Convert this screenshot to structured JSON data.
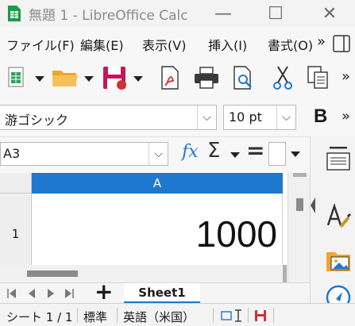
{
  "window": {
    "title": "無題 1 - LibreOffice Calc",
    "minimize": "—",
    "maximize": "☐",
    "close": "✕"
  },
  "menu": {
    "items": [
      "ファイル(F)",
      "編集(E)",
      "表示(V)",
      "挿入(I)",
      "書式(O)"
    ],
    "overflow": "»"
  },
  "toolbar": {
    "icons": [
      "new-spreadsheet-icon",
      "open-folder-icon",
      "save-icon",
      "export-pdf-icon",
      "print-icon",
      "print-preview-icon",
      "cut-icon",
      "copy-icon"
    ],
    "overflow": "»"
  },
  "format": {
    "font_name": "游ゴシック",
    "font_size": "10 pt",
    "bold": "B",
    "overflow": "»"
  },
  "formula": {
    "name_box": "A3",
    "fx": "fx",
    "sum": "Σ",
    "equals": "="
  },
  "grid": {
    "column_header": "A",
    "row_header": "1",
    "cell_a1": "1000"
  },
  "tabs": {
    "add": "+",
    "sheet": "Sheet1"
  },
  "status": {
    "sheet_pos": "シート 1 / 1",
    "page_style": "標準",
    "language": "英語（米国）"
  },
  "colors": {
    "accent": "#1e78d0",
    "save_red": "#d03030"
  }
}
